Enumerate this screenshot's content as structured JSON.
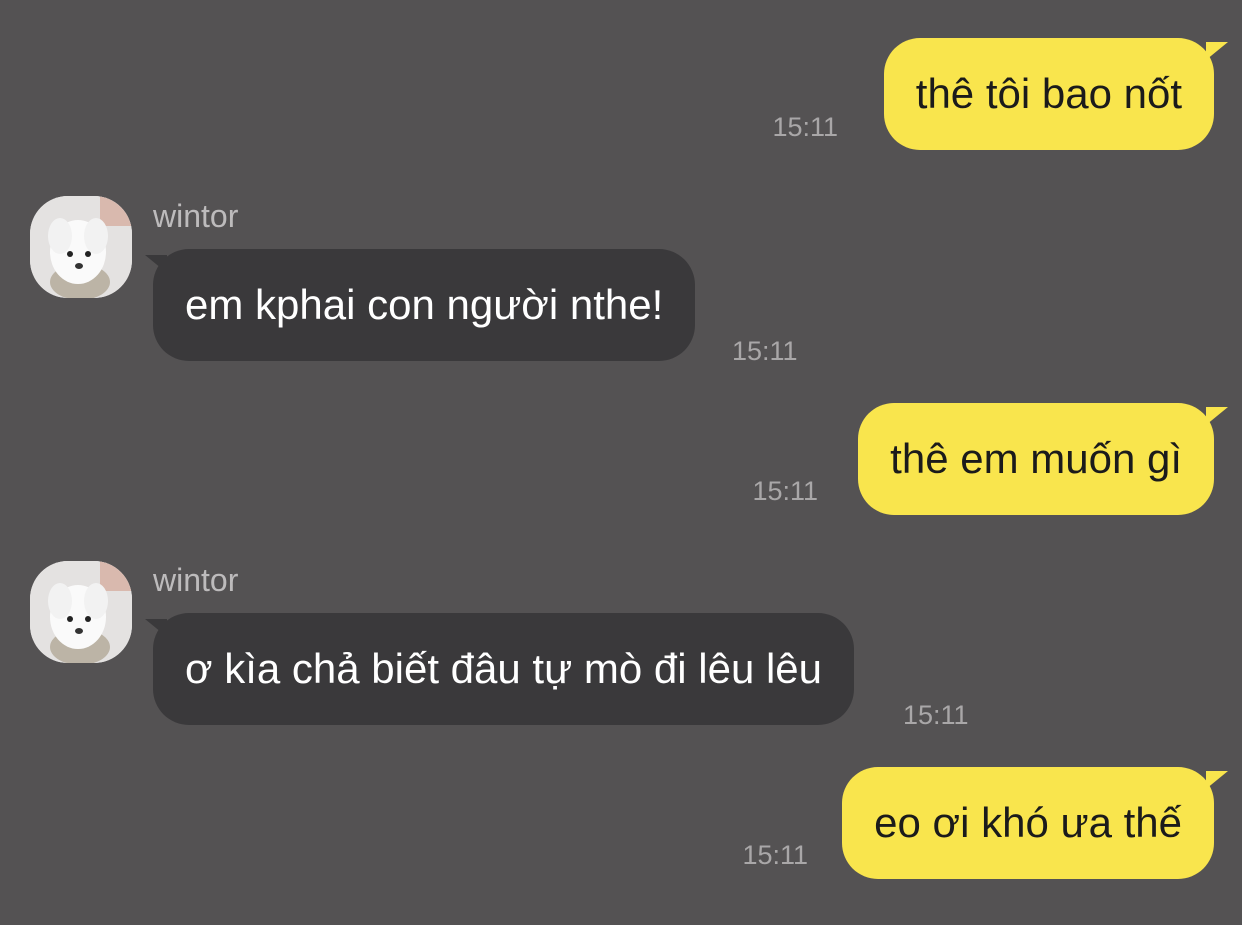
{
  "messages": [
    {
      "direction": "outgoing",
      "text": "thê tôi bao nốt",
      "time": "15:11"
    },
    {
      "direction": "incoming",
      "sender": "wintor",
      "avatar_icon": "puppy-avatar-icon",
      "text": "em kphai con người nthe!",
      "time": "15:11"
    },
    {
      "direction": "outgoing",
      "text": "thê em muốn gì",
      "time": "15:11"
    },
    {
      "direction": "incoming",
      "sender": "wintor",
      "avatar_icon": "puppy-avatar-icon",
      "text": "ơ kìa chả biết đâu tự mò đi lêu lêu",
      "time": "15:11"
    },
    {
      "direction": "outgoing",
      "text": "eo ơi khó ưa thế",
      "time": "15:11"
    }
  ],
  "colors": {
    "background": "#545253",
    "outgoing_bubble": "#f9e54d",
    "incoming_bubble": "#3a393b",
    "timestamp": "#a9a7a8",
    "sender_name": "#bdbbbc"
  }
}
